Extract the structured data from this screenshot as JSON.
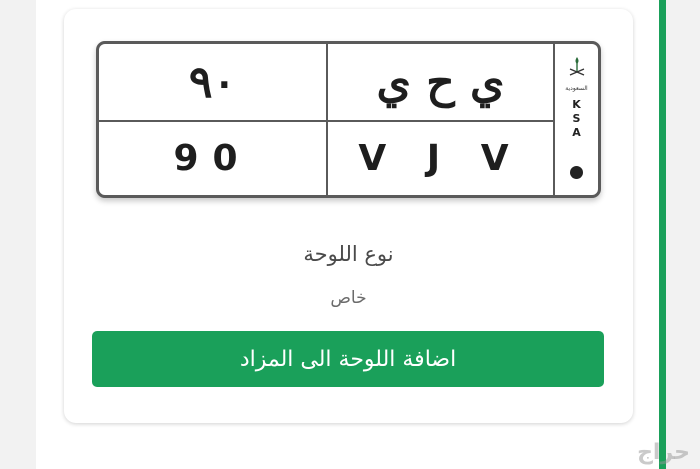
{
  "plate": {
    "arabic_letters": "ي ح ي",
    "arabic_numbers": "٩٠",
    "english_letters": "V J V",
    "english_numbers": "90",
    "country_code": [
      "K",
      "S",
      "A"
    ],
    "emblem_text": "السعودية"
  },
  "details": {
    "plate_type_label": "نوع اللوحة",
    "plate_type_value": "خاص"
  },
  "actions": {
    "add_to_auction_label": "اضافة اللوحة الى المزاد"
  },
  "watermark": "حراج",
  "colors": {
    "accent": "#1aa05a",
    "plate_border": "#5a5a5a",
    "text_dark": "#4a4a4a"
  }
}
